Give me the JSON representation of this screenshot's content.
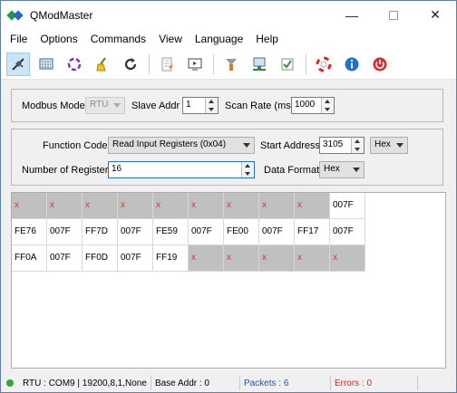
{
  "window": {
    "title": "QModMaster",
    "minimize": "—",
    "close": "✕"
  },
  "menu": [
    "File",
    "Options",
    "Commands",
    "View",
    "Language",
    "Help"
  ],
  "toolbar": {
    "icons": [
      "connect-icon",
      "bus-monitor-icon",
      "scan-icon",
      "clear-icon",
      "reset-icon",
      "log-icon",
      "screen-icon",
      "tools-icon",
      "modbus-settings-icon",
      "checklist-icon",
      "help-icon",
      "about-icon",
      "exit-icon"
    ]
  },
  "settings": {
    "modbus_mode_label": "Modbus Mode",
    "modbus_mode_value": "RTU",
    "slave_addr_label": "Slave Addr",
    "slave_addr_value": "1",
    "scan_rate_label": "Scan Rate (ms)",
    "scan_rate_value": "1000"
  },
  "request": {
    "function_code_label": "Function Code",
    "function_code_value": "Read Input Registers (0x04)",
    "start_address_label": "Start Address",
    "start_address_value": "3105",
    "start_address_format": "Hex",
    "num_registers_label": "Number of Registers",
    "num_registers_value": "16",
    "data_format_label": "Data Format",
    "data_format_value": "Hex"
  },
  "registers": {
    "rows": [
      [
        "x",
        "x",
        "x",
        "x",
        "x",
        "x",
        "x",
        "x",
        "x",
        "007F"
      ],
      [
        "FE76",
        "007F",
        "FF7D",
        "007F",
        "FE59",
        "007F",
        "FE00",
        "007F",
        "FF17",
        "007F"
      ],
      [
        "FF0A",
        "007F",
        "FF0D",
        "007F",
        "FF19",
        "x",
        "x",
        "x",
        "x",
        "x"
      ]
    ],
    "empty_marker": "x"
  },
  "status": {
    "connection": "RTU : COM9 | 19200,8,1,None",
    "base_addr": "Base Addr : 0",
    "packets": "Packets : 6",
    "errors": "Errors : 0"
  },
  "colors": {
    "accent": "#1f4fbf",
    "error": "#e02020",
    "led": "#2ea82e",
    "empty_cell": "#c0c0c0"
  }
}
